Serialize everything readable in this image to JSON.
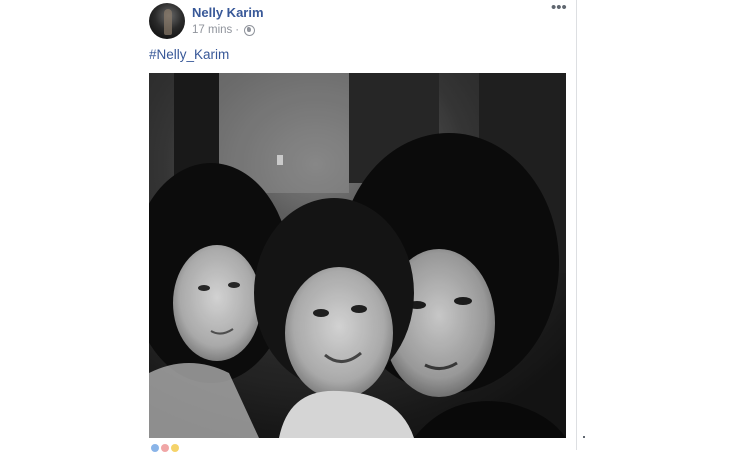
{
  "post": {
    "author": "Nelly Karim",
    "time": "17 mins",
    "separator": "·",
    "privacy_icon": "globe-icon",
    "more_label": "•••",
    "hashtag": "#Nelly_Karim",
    "photo_icon": "photo"
  },
  "colors": {
    "link": "#385898",
    "meta": "#90949c",
    "border": "#dddfe2"
  }
}
